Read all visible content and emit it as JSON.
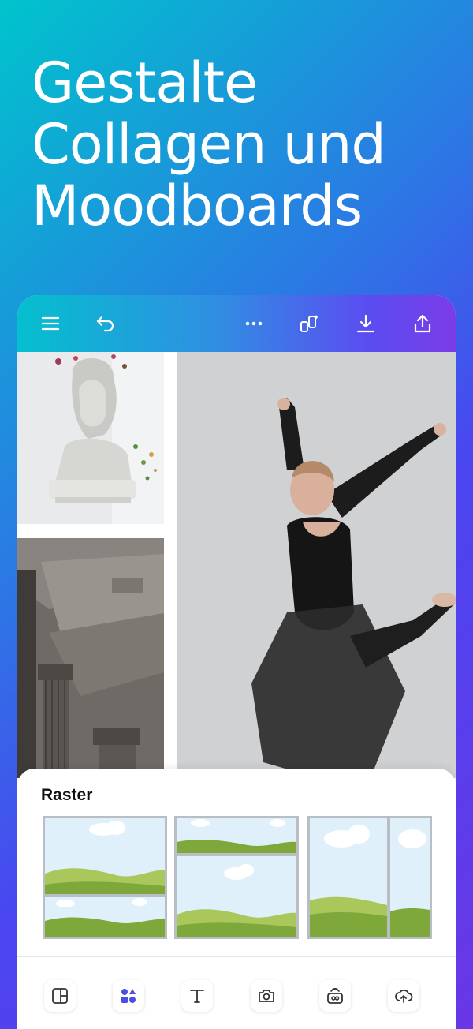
{
  "headline": {
    "lines": [
      "Gestalte",
      "Collagen und",
      "Moodboards"
    ]
  },
  "toolbar": {
    "icons": [
      "menu-icon",
      "undo-icon",
      "more-icon",
      "magic-resize-icon",
      "download-icon",
      "share-icon"
    ]
  },
  "canvas": {
    "photos": [
      "statue-bust-photo",
      "architecture-columns-photo",
      "dancer-photo"
    ]
  },
  "sheet": {
    "title": "Raster",
    "grid_options": [
      "grid-two-rows",
      "grid-small-top-large-bottom",
      "grid-two-columns"
    ]
  },
  "bottom_bar": {
    "icons": [
      "layout-icon",
      "elements-icon",
      "text-icon",
      "camera-icon",
      "brand-icon",
      "upload-icon"
    ]
  },
  "colors": {
    "background_start": "#00c4cc",
    "background_end": "#6a36e6",
    "elements_accent": "#4a4ee6"
  }
}
